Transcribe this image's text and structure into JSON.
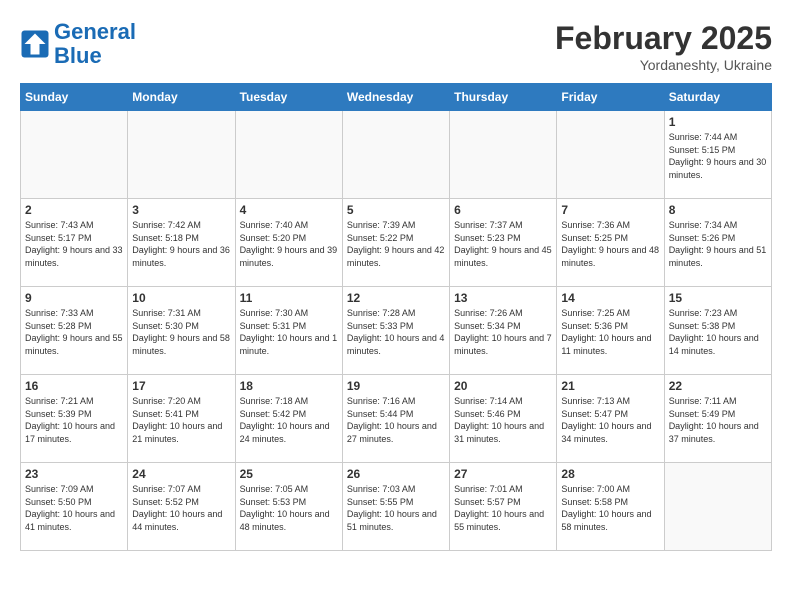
{
  "header": {
    "logo_line1": "General",
    "logo_line2": "Blue",
    "month_title": "February 2025",
    "subtitle": "Yordaneshty, Ukraine"
  },
  "days_of_week": [
    "Sunday",
    "Monday",
    "Tuesday",
    "Wednesday",
    "Thursday",
    "Friday",
    "Saturday"
  ],
  "weeks": [
    [
      {
        "day": "",
        "info": ""
      },
      {
        "day": "",
        "info": ""
      },
      {
        "day": "",
        "info": ""
      },
      {
        "day": "",
        "info": ""
      },
      {
        "day": "",
        "info": ""
      },
      {
        "day": "",
        "info": ""
      },
      {
        "day": "1",
        "info": "Sunrise: 7:44 AM\nSunset: 5:15 PM\nDaylight: 9 hours and 30 minutes."
      }
    ],
    [
      {
        "day": "2",
        "info": "Sunrise: 7:43 AM\nSunset: 5:17 PM\nDaylight: 9 hours and 33 minutes."
      },
      {
        "day": "3",
        "info": "Sunrise: 7:42 AM\nSunset: 5:18 PM\nDaylight: 9 hours and 36 minutes."
      },
      {
        "day": "4",
        "info": "Sunrise: 7:40 AM\nSunset: 5:20 PM\nDaylight: 9 hours and 39 minutes."
      },
      {
        "day": "5",
        "info": "Sunrise: 7:39 AM\nSunset: 5:22 PM\nDaylight: 9 hours and 42 minutes."
      },
      {
        "day": "6",
        "info": "Sunrise: 7:37 AM\nSunset: 5:23 PM\nDaylight: 9 hours and 45 minutes."
      },
      {
        "day": "7",
        "info": "Sunrise: 7:36 AM\nSunset: 5:25 PM\nDaylight: 9 hours and 48 minutes."
      },
      {
        "day": "8",
        "info": "Sunrise: 7:34 AM\nSunset: 5:26 PM\nDaylight: 9 hours and 51 minutes."
      }
    ],
    [
      {
        "day": "9",
        "info": "Sunrise: 7:33 AM\nSunset: 5:28 PM\nDaylight: 9 hours and 55 minutes."
      },
      {
        "day": "10",
        "info": "Sunrise: 7:31 AM\nSunset: 5:30 PM\nDaylight: 9 hours and 58 minutes."
      },
      {
        "day": "11",
        "info": "Sunrise: 7:30 AM\nSunset: 5:31 PM\nDaylight: 10 hours and 1 minute."
      },
      {
        "day": "12",
        "info": "Sunrise: 7:28 AM\nSunset: 5:33 PM\nDaylight: 10 hours and 4 minutes."
      },
      {
        "day": "13",
        "info": "Sunrise: 7:26 AM\nSunset: 5:34 PM\nDaylight: 10 hours and 7 minutes."
      },
      {
        "day": "14",
        "info": "Sunrise: 7:25 AM\nSunset: 5:36 PM\nDaylight: 10 hours and 11 minutes."
      },
      {
        "day": "15",
        "info": "Sunrise: 7:23 AM\nSunset: 5:38 PM\nDaylight: 10 hours and 14 minutes."
      }
    ],
    [
      {
        "day": "16",
        "info": "Sunrise: 7:21 AM\nSunset: 5:39 PM\nDaylight: 10 hours and 17 minutes."
      },
      {
        "day": "17",
        "info": "Sunrise: 7:20 AM\nSunset: 5:41 PM\nDaylight: 10 hours and 21 minutes."
      },
      {
        "day": "18",
        "info": "Sunrise: 7:18 AM\nSunset: 5:42 PM\nDaylight: 10 hours and 24 minutes."
      },
      {
        "day": "19",
        "info": "Sunrise: 7:16 AM\nSunset: 5:44 PM\nDaylight: 10 hours and 27 minutes."
      },
      {
        "day": "20",
        "info": "Sunrise: 7:14 AM\nSunset: 5:46 PM\nDaylight: 10 hours and 31 minutes."
      },
      {
        "day": "21",
        "info": "Sunrise: 7:13 AM\nSunset: 5:47 PM\nDaylight: 10 hours and 34 minutes."
      },
      {
        "day": "22",
        "info": "Sunrise: 7:11 AM\nSunset: 5:49 PM\nDaylight: 10 hours and 37 minutes."
      }
    ],
    [
      {
        "day": "23",
        "info": "Sunrise: 7:09 AM\nSunset: 5:50 PM\nDaylight: 10 hours and 41 minutes."
      },
      {
        "day": "24",
        "info": "Sunrise: 7:07 AM\nSunset: 5:52 PM\nDaylight: 10 hours and 44 minutes."
      },
      {
        "day": "25",
        "info": "Sunrise: 7:05 AM\nSunset: 5:53 PM\nDaylight: 10 hours and 48 minutes."
      },
      {
        "day": "26",
        "info": "Sunrise: 7:03 AM\nSunset: 5:55 PM\nDaylight: 10 hours and 51 minutes."
      },
      {
        "day": "27",
        "info": "Sunrise: 7:01 AM\nSunset: 5:57 PM\nDaylight: 10 hours and 55 minutes."
      },
      {
        "day": "28",
        "info": "Sunrise: 7:00 AM\nSunset: 5:58 PM\nDaylight: 10 hours and 58 minutes."
      },
      {
        "day": "",
        "info": ""
      }
    ]
  ]
}
